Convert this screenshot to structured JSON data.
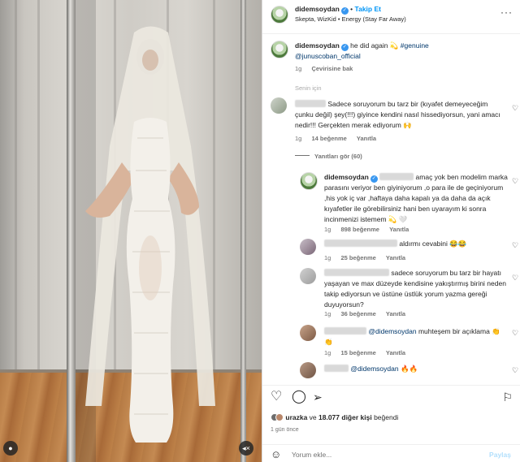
{
  "post": {
    "username": "didemsoydan",
    "follow_label": "Takip Et",
    "dot_separator": "•",
    "audio": "Skepta, WizKid • Energy (Stay Far Away)",
    "caption_text": "he did again 💫 ",
    "caption_hashtag": "#genuine",
    "caption_mention": "@junuscoban_official",
    "caption_time": "1g",
    "translate_label": "Çevirisine bak",
    "section_label": "Senin için"
  },
  "comments": [
    {
      "text": "Sadece soruyorum bu tarz bir (kıyafet demeyeceğim çunku değil) şey(!!!) giyince kendini nasıl hissediyorsun, yani amacı nedir!!! Gerçekten merak ediyorum 🙌",
      "time": "1g",
      "likes": "14 beğenme",
      "reply": "Yanıtla"
    }
  ],
  "replies_toggle": "Yanıtları gör (60)",
  "replies": [
    {
      "username": "didemsoydan",
      "text": " amaç yok ben modelim marka parasını veriyor ben giyiniyorum ,o para ile de geçiniyorum ,his yok iç var ,haftaya daha kapalı ya da daha da açık kıyafetler ile görebilirsiniz hani ben uyarayım ki sonra incinmenizi istemem 💫 🤍",
      "time": "1g",
      "likes": "898 beğenme",
      "reply": "Yanıtla"
    },
    {
      "text": "aldırmı cevabini 😂😂",
      "time": "1g",
      "likes": "25 beğenme",
      "reply": "Yanıtla"
    },
    {
      "text": " sadece soruyorum bu tarz bir hayatı yaşayan ve max düzeyde kendisine yakıştırmış birini neden takip ediyorsun ve üstüne üstlük yorum yazma gereği duyuyorsun?",
      "time": "1g",
      "likes": "36 beğenme",
      "reply": "Yanıtla"
    },
    {
      "mention": "@didemsoydan",
      "text": " muhteşem bir açıklama 👏👏",
      "time": "1g",
      "likes": "15 beğenme",
      "reply": "Yanıtla"
    },
    {
      "mention": "@didemsoydan",
      "text": " 🔥🔥"
    }
  ],
  "actions": {
    "liker": "urazka",
    "likes_middle": " ve ",
    "likes_count": "18.077 diğer kişi",
    "likes_suffix": " beğendi",
    "time_ago": "1 gün önce",
    "comment_placeholder": "Yorum ekle...",
    "post_label": "Paylaş"
  },
  "icons": {
    "more": "more-dots-icon",
    "heart": "heart-icon",
    "comment": "comment-icon",
    "share": "share-icon",
    "save": "bookmark-icon",
    "emoji": "emoji-icon",
    "profile": "profile-icon",
    "mute": "mute-icon"
  },
  "colors": {
    "link_blue": "#0095f6",
    "mention_blue": "#00376b",
    "verified": "#3897f0",
    "muted": "#737373"
  }
}
